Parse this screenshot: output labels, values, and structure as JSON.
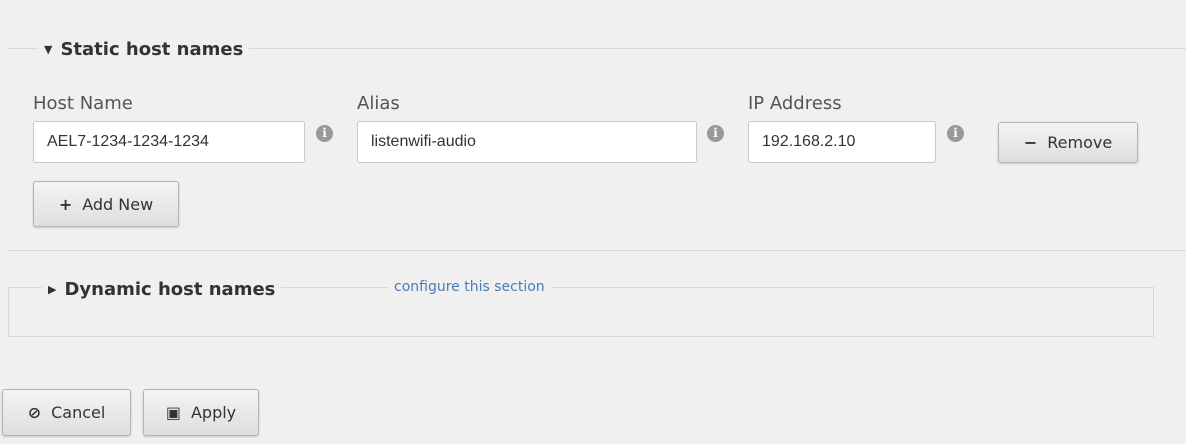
{
  "static_section": {
    "title": "Static host names",
    "columns": {
      "host_name": "Host Name",
      "alias": "Alias",
      "ip_address": "IP Address"
    },
    "row": {
      "host_name": "AEL7-1234-1234-1234",
      "alias": "listenwifi-audio",
      "ip_address": "192.168.2.10"
    },
    "info_glyph": "i",
    "remove_label": "Remove",
    "remove_glyph": "−",
    "add_label": "Add New",
    "add_glyph": "+"
  },
  "dynamic_section": {
    "title": "Dynamic host names",
    "configure_link": "configure this section"
  },
  "footer": {
    "cancel_label": "Cancel",
    "cancel_glyph": "⊘",
    "apply_label": "Apply",
    "apply_glyph": "▣"
  },
  "icons": {
    "caret_down": "▼",
    "caret_right": "▶"
  },
  "colors": {
    "background": "#f0f0f0",
    "link": "#4a7bb7",
    "border": "#d8d8d8",
    "info_icon": "#999999"
  }
}
